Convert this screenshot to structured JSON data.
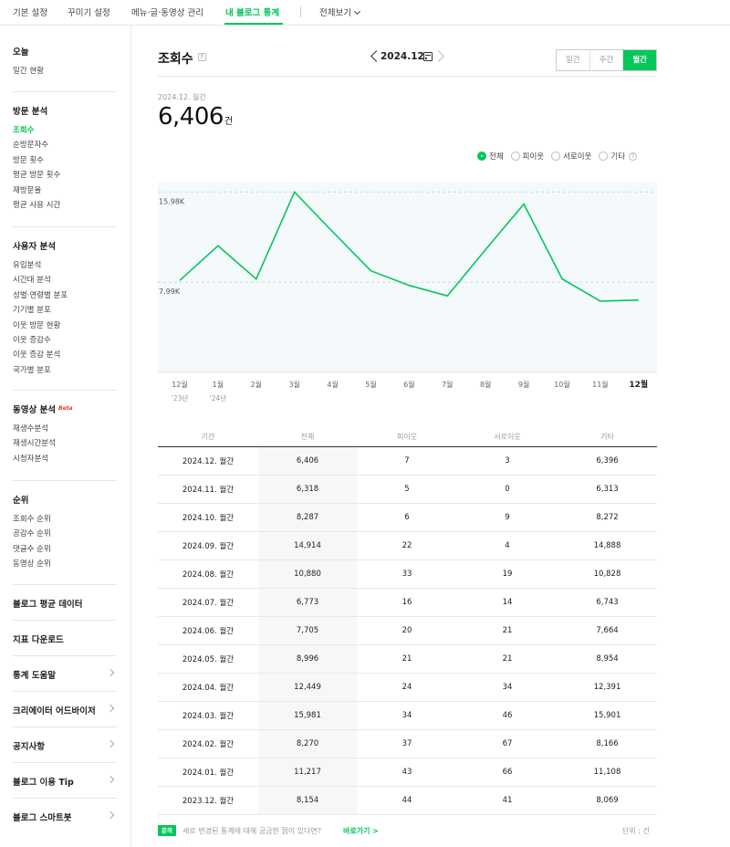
{
  "nav": {
    "tabs": [
      "기본 설정",
      "꾸미기 설정",
      "메뉴·글·동영상 관리",
      "내 블로그 통계"
    ],
    "view_all": "전체보기"
  },
  "sidebar": {
    "today": {
      "title": "오늘",
      "items": [
        "일간 현황"
      ]
    },
    "visit": {
      "title": "방문 분석",
      "items": [
        "조회수",
        "순방문자수",
        "방문 횟수",
        "평균 방문 횟수",
        "재방문율",
        "평균 사용 시간"
      ]
    },
    "user": {
      "title": "사용자 분석",
      "items": [
        "유입분석",
        "시간대 분석",
        "성별·연령별 분포",
        "기기별 분포",
        "이웃 방문 현황",
        "이웃 증감수",
        "이웃 증감 분석",
        "국가별 분포"
      ]
    },
    "video": {
      "title": "동영상 분석",
      "beta": "Beta",
      "items": [
        "재생수분석",
        "재생시간분석",
        "시청자분석"
      ]
    },
    "rank": {
      "title": "순위",
      "items": [
        "조회수 순위",
        "공감수 순위",
        "댓글수 순위",
        "동영상 순위"
      ]
    },
    "links": [
      "블로그 평균 데이터",
      "지표 다운로드",
      "통계 도움말",
      "크리에이터 어드바이저",
      "공지사항",
      "블로그 이용 Tip",
      "블로그 스마트봇"
    ]
  },
  "header": {
    "title": "조회수",
    "help": "?",
    "date": "2024.12.",
    "period_tabs": [
      "일간",
      "주간",
      "월간"
    ]
  },
  "summary": {
    "date": "2024.12. 월간",
    "value": "6,406",
    "unit": "건"
  },
  "filters": {
    "options": [
      "전체",
      "피이웃",
      "서로이웃",
      "기타"
    ],
    "help": "?"
  },
  "colors": {
    "accent": "#03c75a",
    "chart_bg": "#f4f9fc"
  },
  "chart_data": {
    "type": "line",
    "categories": [
      "12월",
      "1월",
      "2월",
      "3월",
      "4월",
      "5월",
      "6월",
      "7월",
      "8월",
      "9월",
      "10월",
      "11월",
      "12월"
    ],
    "sub_labels": [
      "'23년",
      "'24년",
      "",
      "",
      "",
      "",
      "",
      "",
      "",
      "",
      "",
      "",
      ""
    ],
    "series": [
      {
        "values": [
          8154,
          11217,
          8270,
          15981,
          12449,
          8996,
          7705,
          6773,
          10880,
          14914,
          8287,
          6318,
          6406
        ]
      }
    ],
    "y_ticks": [
      {
        "value": 7990,
        "label": "7.99K"
      },
      {
        "value": 15980,
        "label": "15.98K"
      }
    ],
    "ylim": [
      0,
      16900
    ],
    "highlight_last": true,
    "grid": true
  },
  "table": {
    "headers": [
      "기간",
      "전체",
      "피이웃",
      "서로이웃",
      "기타"
    ],
    "rows": [
      [
        "2024.12. 월간",
        "6,406",
        "7",
        "3",
        "6,396"
      ],
      [
        "2024.11. 월간",
        "6,318",
        "5",
        "0",
        "6,313"
      ],
      [
        "2024.10. 월간",
        "8,287",
        "6",
        "9",
        "8,272"
      ],
      [
        "2024.09. 월간",
        "14,914",
        "22",
        "4",
        "14,888"
      ],
      [
        "2024.08. 월간",
        "10,880",
        "33",
        "19",
        "10,828"
      ],
      [
        "2024.07. 월간",
        "6,773",
        "16",
        "14",
        "6,743"
      ],
      [
        "2024.06. 월간",
        "7,705",
        "20",
        "21",
        "7,664"
      ],
      [
        "2024.05. 월간",
        "8,996",
        "21",
        "21",
        "8,954"
      ],
      [
        "2024.04. 월간",
        "12,449",
        "24",
        "34",
        "12,391"
      ],
      [
        "2024.03. 월간",
        "15,981",
        "34",
        "46",
        "15,901"
      ],
      [
        "2024.02. 월간",
        "8,270",
        "37",
        "67",
        "8,166"
      ],
      [
        "2024.01. 월간",
        "11,217",
        "43",
        "66",
        "11,108"
      ],
      [
        "2023.12. 월간",
        "8,154",
        "44",
        "41",
        "8,069"
      ]
    ]
  },
  "footer": {
    "badge": "문의",
    "text": "새로 변경된 통계에 대해 궁금한 점이 있다면?",
    "link": "바로가기 >",
    "unit": "단위 : 건"
  }
}
